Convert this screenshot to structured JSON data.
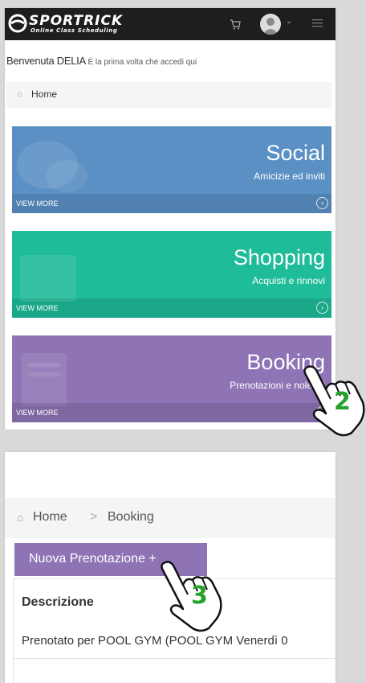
{
  "app": {
    "logo_text": "SPORTRICK",
    "logo_sub": "Online Class Scheduling",
    "welcome_name": "Benvenuta DELIA",
    "welcome_note": "È la prima volta che accedi qui"
  },
  "header": {
    "cart_icon": "cart-icon",
    "avatar_icon": "user-avatar",
    "menu_icon": "hamburger-icon"
  },
  "breadcrumb_top": {
    "home": "Home"
  },
  "tiles": [
    {
      "title": "Social",
      "subtitle": "Amicizie ed inviti",
      "link": "VIEW MORE",
      "color": "#5b90c4"
    },
    {
      "title": "Shopping",
      "subtitle": "Acquisti e rinnovi",
      "link": "VIEW MORE",
      "color": "#1fbc99"
    },
    {
      "title": "Booking",
      "subtitle": "Prenotazioni e noleggi",
      "link": "VIEW MORE",
      "color": "#8e74b5"
    }
  ],
  "booking_page": {
    "breadcrumb_home": "Home",
    "breadcrumb_sep": ">",
    "breadcrumb_current": "Booking",
    "new_button": "Nuova Prenotazione +",
    "table_header": "Descrizione",
    "rows": [
      "Prenotato per POOL GYM (POOL GYM Venerdì 0"
    ]
  },
  "annotations": {
    "step_a": "2",
    "step_b": "3",
    "color": "#25a32c"
  }
}
